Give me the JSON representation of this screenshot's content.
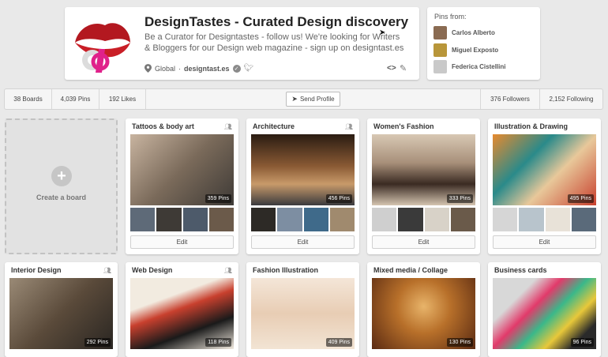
{
  "profile": {
    "title": "DesignTastes - Curated Design discovery",
    "description": "Be a Curator for Designtastes - follow us! We're looking for Writers & Bloggers for our Design web magazine - sign up on designtast.es",
    "location": "Global",
    "separator": "·",
    "website": "designtast.es"
  },
  "pins_from": {
    "heading": "Pins from:",
    "users": [
      {
        "name": "Carlos Alberto",
        "color": "#8a6b52"
      },
      {
        "name": "Miguel Exposto",
        "color": "#b8963a"
      },
      {
        "name": "Federica Cistellini",
        "color": "#c9c9c9"
      }
    ]
  },
  "stats": {
    "boards": "38 Boards",
    "pins": "4,039 Pins",
    "likes": "192 Likes",
    "send_profile": "Send Profile",
    "followers": "376 Followers",
    "following": "2,152 Following"
  },
  "create_board": {
    "label": "Create a board"
  },
  "boards_row1": [
    {
      "name": "Tattoos & body art",
      "pins": "359 Pins",
      "edit": "Edit",
      "cover": "#9b8672",
      "thumbs": [
        "#5e6a78",
        "#3e3a36",
        "#4d5a6a",
        "#6b5a4a"
      ]
    },
    {
      "name": "Architecture",
      "pins": "456 Pins",
      "edit": "Edit",
      "cover": "#6e4a2c",
      "thumbs": [
        "#2d2a26",
        "#7d8ea2",
        "#3f6a8a",
        "#a08a6e"
      ]
    },
    {
      "name": "Women's Fashion",
      "pins": "333 Pins",
      "edit": "Edit",
      "cover": "#c9b7a3",
      "thumbs": [
        "#cfcfcf",
        "#3a3a3a",
        "#d8d2c8",
        "#6a5a4a"
      ]
    },
    {
      "name": "Illustration & Drawing",
      "pins": "495 Pins",
      "edit": "Edit",
      "cover": "#d8852e",
      "thumbs": [
        "#d6d6d6",
        "#b8c4cc",
        "#e8e2d8",
        "#5a6a7a"
      ]
    }
  ],
  "boards_row2": [
    {
      "name": "Interior Design",
      "pins": "292 Pins",
      "cover": "#7a6a56"
    },
    {
      "name": "Web Design",
      "pins": "118 Pins",
      "cover": "#c8402e"
    },
    {
      "name": "Fashion Illustration",
      "pins": "409 Pins",
      "cover": "#ecd9c6"
    },
    {
      "name": "Mixed media / Collage",
      "pins": "130 Pins",
      "cover": "#9a5a24"
    },
    {
      "name": "Business cards",
      "pins": "96 Pins",
      "cover": "#8a9a6a"
    }
  ]
}
